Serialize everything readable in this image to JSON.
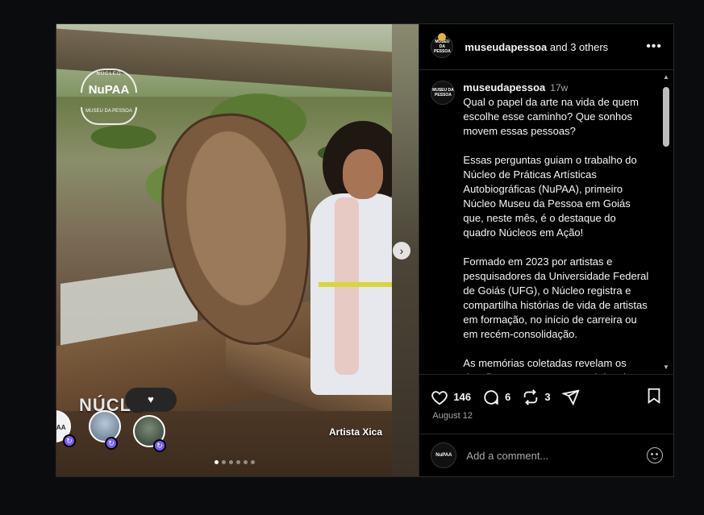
{
  "post": {
    "media": {
      "logo_top": "NÚCLEO",
      "logo_name": "NuPAA",
      "logo_bottom": "MUSEU DA PESSOA",
      "overlay_title": "NÚCLE",
      "credit": "Artista Xica",
      "slide_dots": 6,
      "active_dot": 0,
      "like_bubble": "♥",
      "collab_avatar_label": "NuPAA"
    },
    "header": {
      "avatar_label": "MUSEU DA PESSOA",
      "author": "museudapessoa",
      "collab_text": " and 3 others",
      "more": "•••"
    },
    "caption": {
      "avatar_label": "MUSEU DA PESSOA",
      "author": "museudapessoa",
      "time": "17w",
      "p1": "Qual o papel da arte na vida de quem escolhe esse caminho? Que sonhos movem essas pessoas?",
      "p2": "Essas perguntas guiam o trabalho do Núcleo de Práticas Artísticas Autobiográficas (NuPAA), primeiro Núcleo Museu da Pessoa em Goiás que, neste mês, é o destaque do quadro Núcleos em Ação!",
      "p3": "Formado em 2023 por artistas e pesquisadores da Universidade Federal de Goiás (UFG), o Núcleo registra e compartilha histórias de vida de artistas em formação, no início de carreira ou em recém-consolidação.",
      "p4": "As memórias coletadas revelam os desafios, percursos e estratégias de permanência no campo das Artes"
    },
    "actions": {
      "likes": "146",
      "comments": "6",
      "reposts": "3"
    },
    "date": "August 12",
    "comment_box": {
      "avatar_label": "NuPAA",
      "placeholder": "Add a comment..."
    }
  }
}
